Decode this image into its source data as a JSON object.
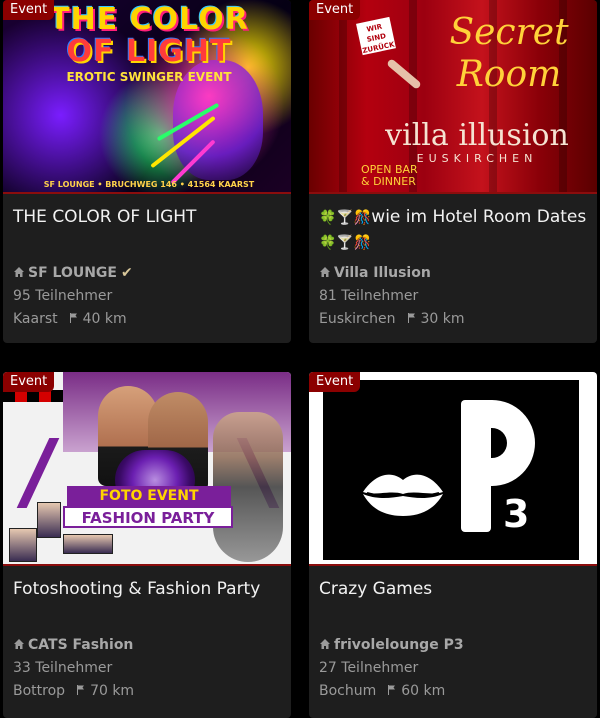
{
  "cards": [
    {
      "badge": "Event",
      "image_alt": "The Color of Light poster",
      "poster": {
        "line1": "THE COLOR",
        "line2": "OF LIGHT",
        "sub": "EROTIC SWINGER EVENT",
        "foot": "SF LOUNGE • BRUCHWEG 146 • 41564 KAARST"
      },
      "title": "THE COLOR OF LIGHT",
      "venue": "SF LOUNGE",
      "verified": true,
      "participants": "95 Teilnehmer",
      "city": "Kaarst",
      "distance": "40 km"
    },
    {
      "badge": "Event",
      "image_alt": "Secret Room Villa Illusion poster",
      "poster": {
        "sticker": "WIR SIND ZURÜCK",
        "secret": "Secret Room",
        "villa": "villa illusion",
        "eusk": "EUSKIRCHEN",
        "openbar1": "OPEN BAR",
        "openbar2": "& DINNER"
      },
      "title_parts": {
        "emojis_lead": "🍀🍸🎊",
        "text": "wie im Hotel Room Dates",
        "emojis_tail": "🍀🍸🎊"
      },
      "venue": "Villa Illusion",
      "participants": "81 Teilnehmer",
      "city": "Euskirchen",
      "distance": "30 km"
    },
    {
      "badge": "Event",
      "image_alt": "Foto Event Fashion Party poster",
      "poster": {
        "foto": "FOTO EVENT",
        "fashion": "FASHION PARTY"
      },
      "title": "Fotoshooting & Fashion Party",
      "venue": "CATS Fashion",
      "participants": "33 Teilnehmer",
      "city": "Bottrop",
      "distance": "70 km"
    },
    {
      "badge": "Event",
      "image_alt": "P3 logo with lips",
      "poster": {
        "three": "3"
      },
      "title": "Crazy Games",
      "venue": "frivolelounge P3",
      "participants": "27 Teilnehmer",
      "city": "Bochum",
      "distance": "60 km"
    }
  ],
  "icons": {
    "venue": "house-icon",
    "distance": "flag-icon",
    "verified": "checkmark-icon"
  },
  "colors": {
    "badge": "#8b0000",
    "card_bg": "#1e1e1e",
    "page_bg": "#000000",
    "title": "#f2f2f2",
    "meta": "#9a9a9a"
  }
}
